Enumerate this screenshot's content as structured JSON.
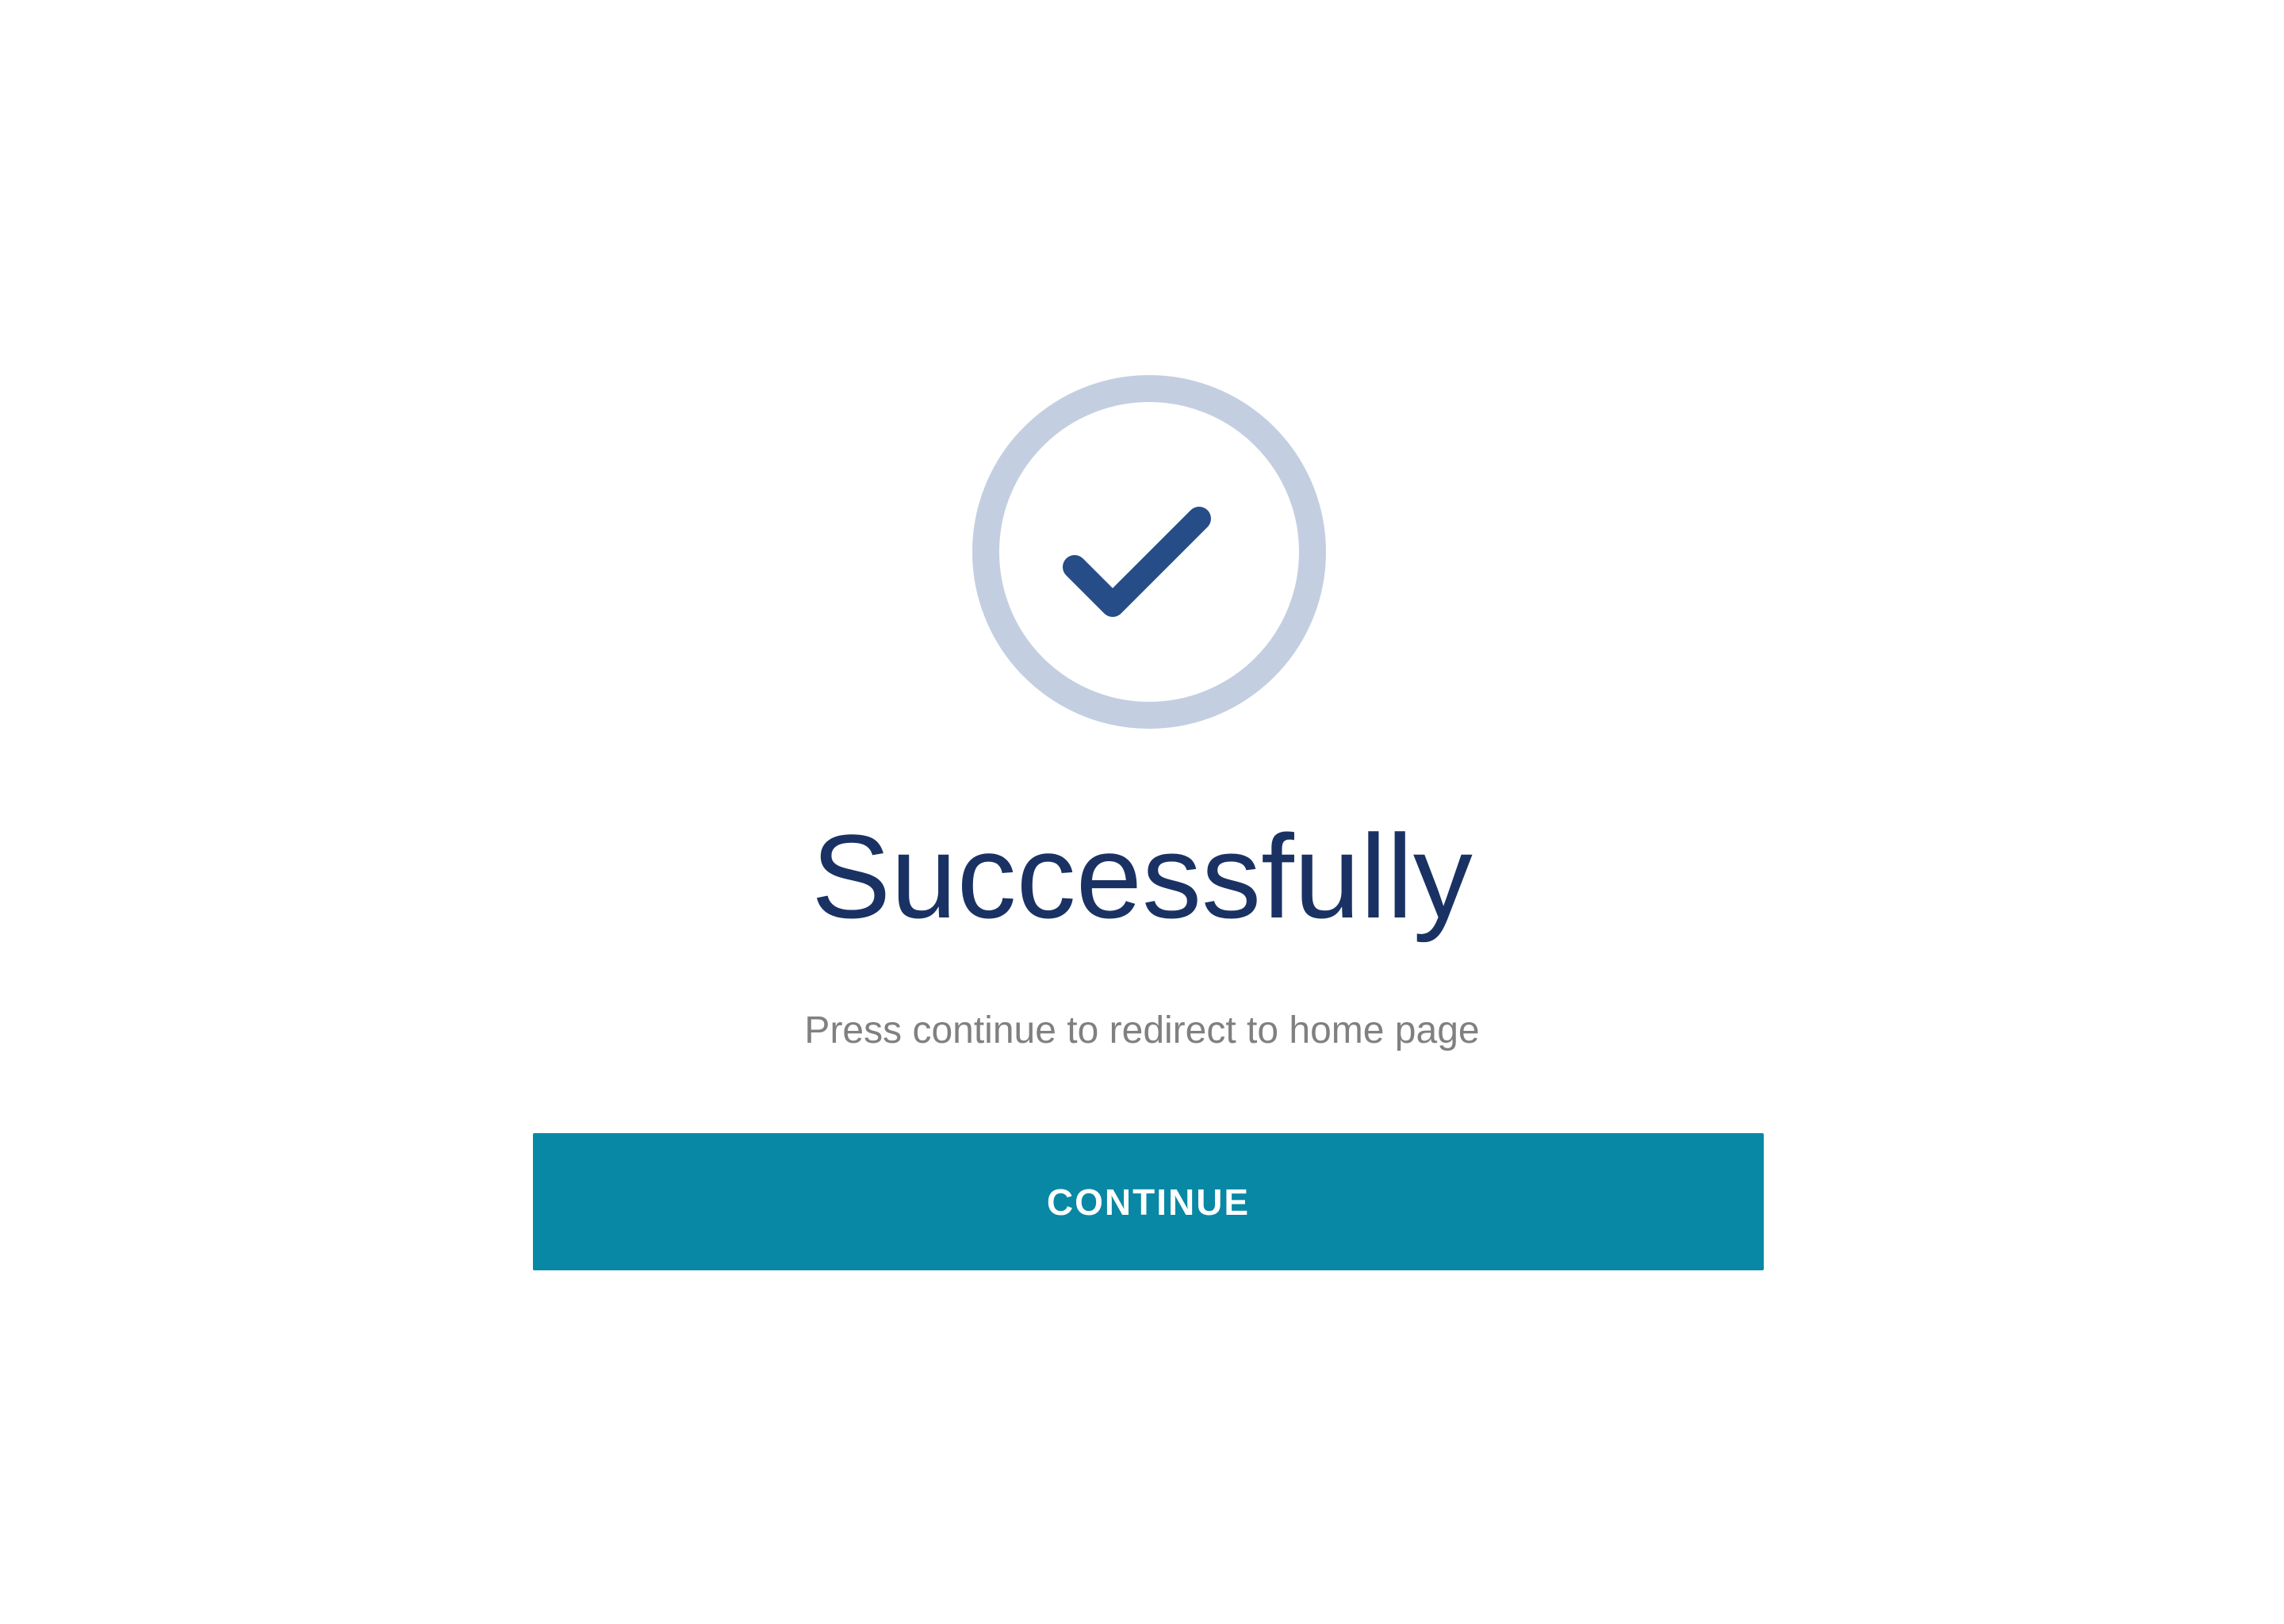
{
  "icon": {
    "name": "check-circle-icon",
    "ring_color": "#c3cfe1",
    "check_color": "#264d87"
  },
  "title": "Successfully",
  "subtitle": "Press continue to redirect to home page",
  "continue_button": {
    "label": "CONTINUE",
    "color": "#0888a5",
    "text_color": "#ffffff"
  }
}
